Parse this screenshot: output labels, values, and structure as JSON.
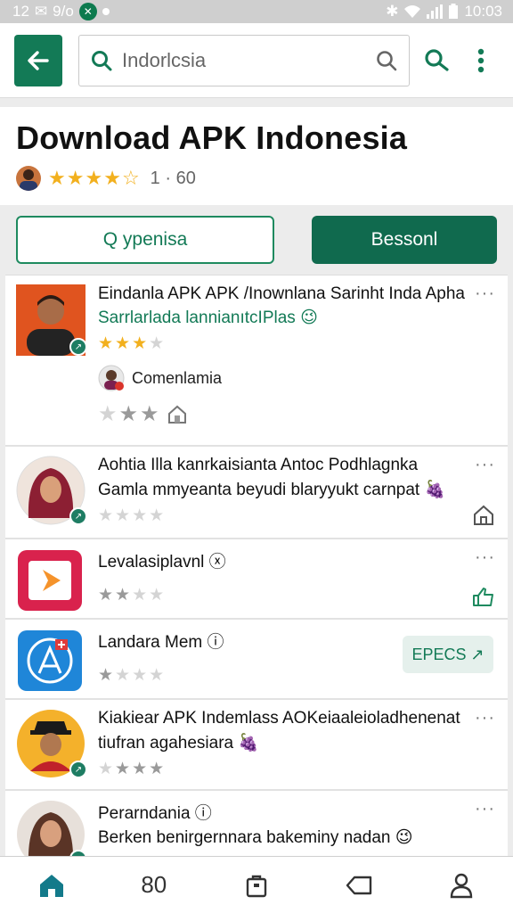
{
  "status": {
    "left": "12",
    "percent": "9/o",
    "time": "10:03"
  },
  "search": {
    "value": "Indorlcsia"
  },
  "header": {
    "title": "Download APK Indonesia",
    "rating_text": "1 · 60"
  },
  "filters": {
    "outline_label": "Q ypenisa",
    "solid_label": "Bessonl"
  },
  "items": [
    {
      "title": "Eindanla APK APK /Inownlana Sarinht Inda Apha",
      "subtitle": "Sarrlarlada lannianıtcIPlas 😉",
      "comment": "Comenlamia"
    },
    {
      "title": "Aohtia Illa kanrkaisianta Antoc Podhlagnka",
      "subtitle": "Gamla mmyeanta beyudi blaryyukt carnpat 🍇"
    },
    {
      "title": "Levalasiplavnl ⓧ"
    },
    {
      "title": "Landara Mem ⓘ",
      "action_label": "EPECS ↗"
    },
    {
      "title": "Kiakiear APK Indemlass AOKeiaaleioladhenenat",
      "subtitle": "tiufran agahesiara 🍇"
    },
    {
      "title": "Perarndania ⓘ",
      "subtitle": "Berken benirgernnara bakeminy nadan 😉"
    }
  ],
  "bottom_nav": {
    "count_label": "80"
  },
  "colors": {
    "brand_green": "#137a56",
    "star_gold": "#f2b01e"
  }
}
